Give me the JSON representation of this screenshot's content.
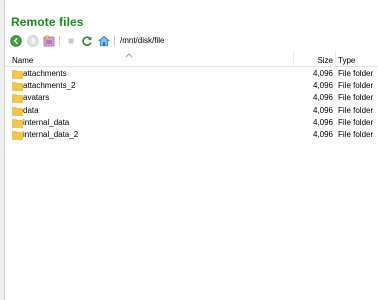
{
  "panel": {
    "title": "Remote files",
    "path": "/mnt/disk/file"
  },
  "toolbar": {
    "buttons": [
      "back-icon",
      "forward-icon",
      "bookmark-icon",
      "stop-icon",
      "refresh-icon",
      "home-icon"
    ]
  },
  "columns": {
    "name": "Name",
    "size": "Size",
    "type": "Type"
  },
  "files": [
    {
      "name": "attachments",
      "size": "4,096",
      "type": "File folder"
    },
    {
      "name": "attachments_2",
      "size": "4,096",
      "type": "File folder"
    },
    {
      "name": "avatars",
      "size": "4,096",
      "type": "File folder"
    },
    {
      "name": "data",
      "size": "4,096",
      "type": "File folder"
    },
    {
      "name": "internal_data",
      "size": "4,096",
      "type": "File folder"
    },
    {
      "name": "internal_data_2",
      "size": "4,096",
      "type": "File folder"
    }
  ],
  "colors": {
    "title": "#1d8a1d",
    "folder": "#f3c648"
  }
}
